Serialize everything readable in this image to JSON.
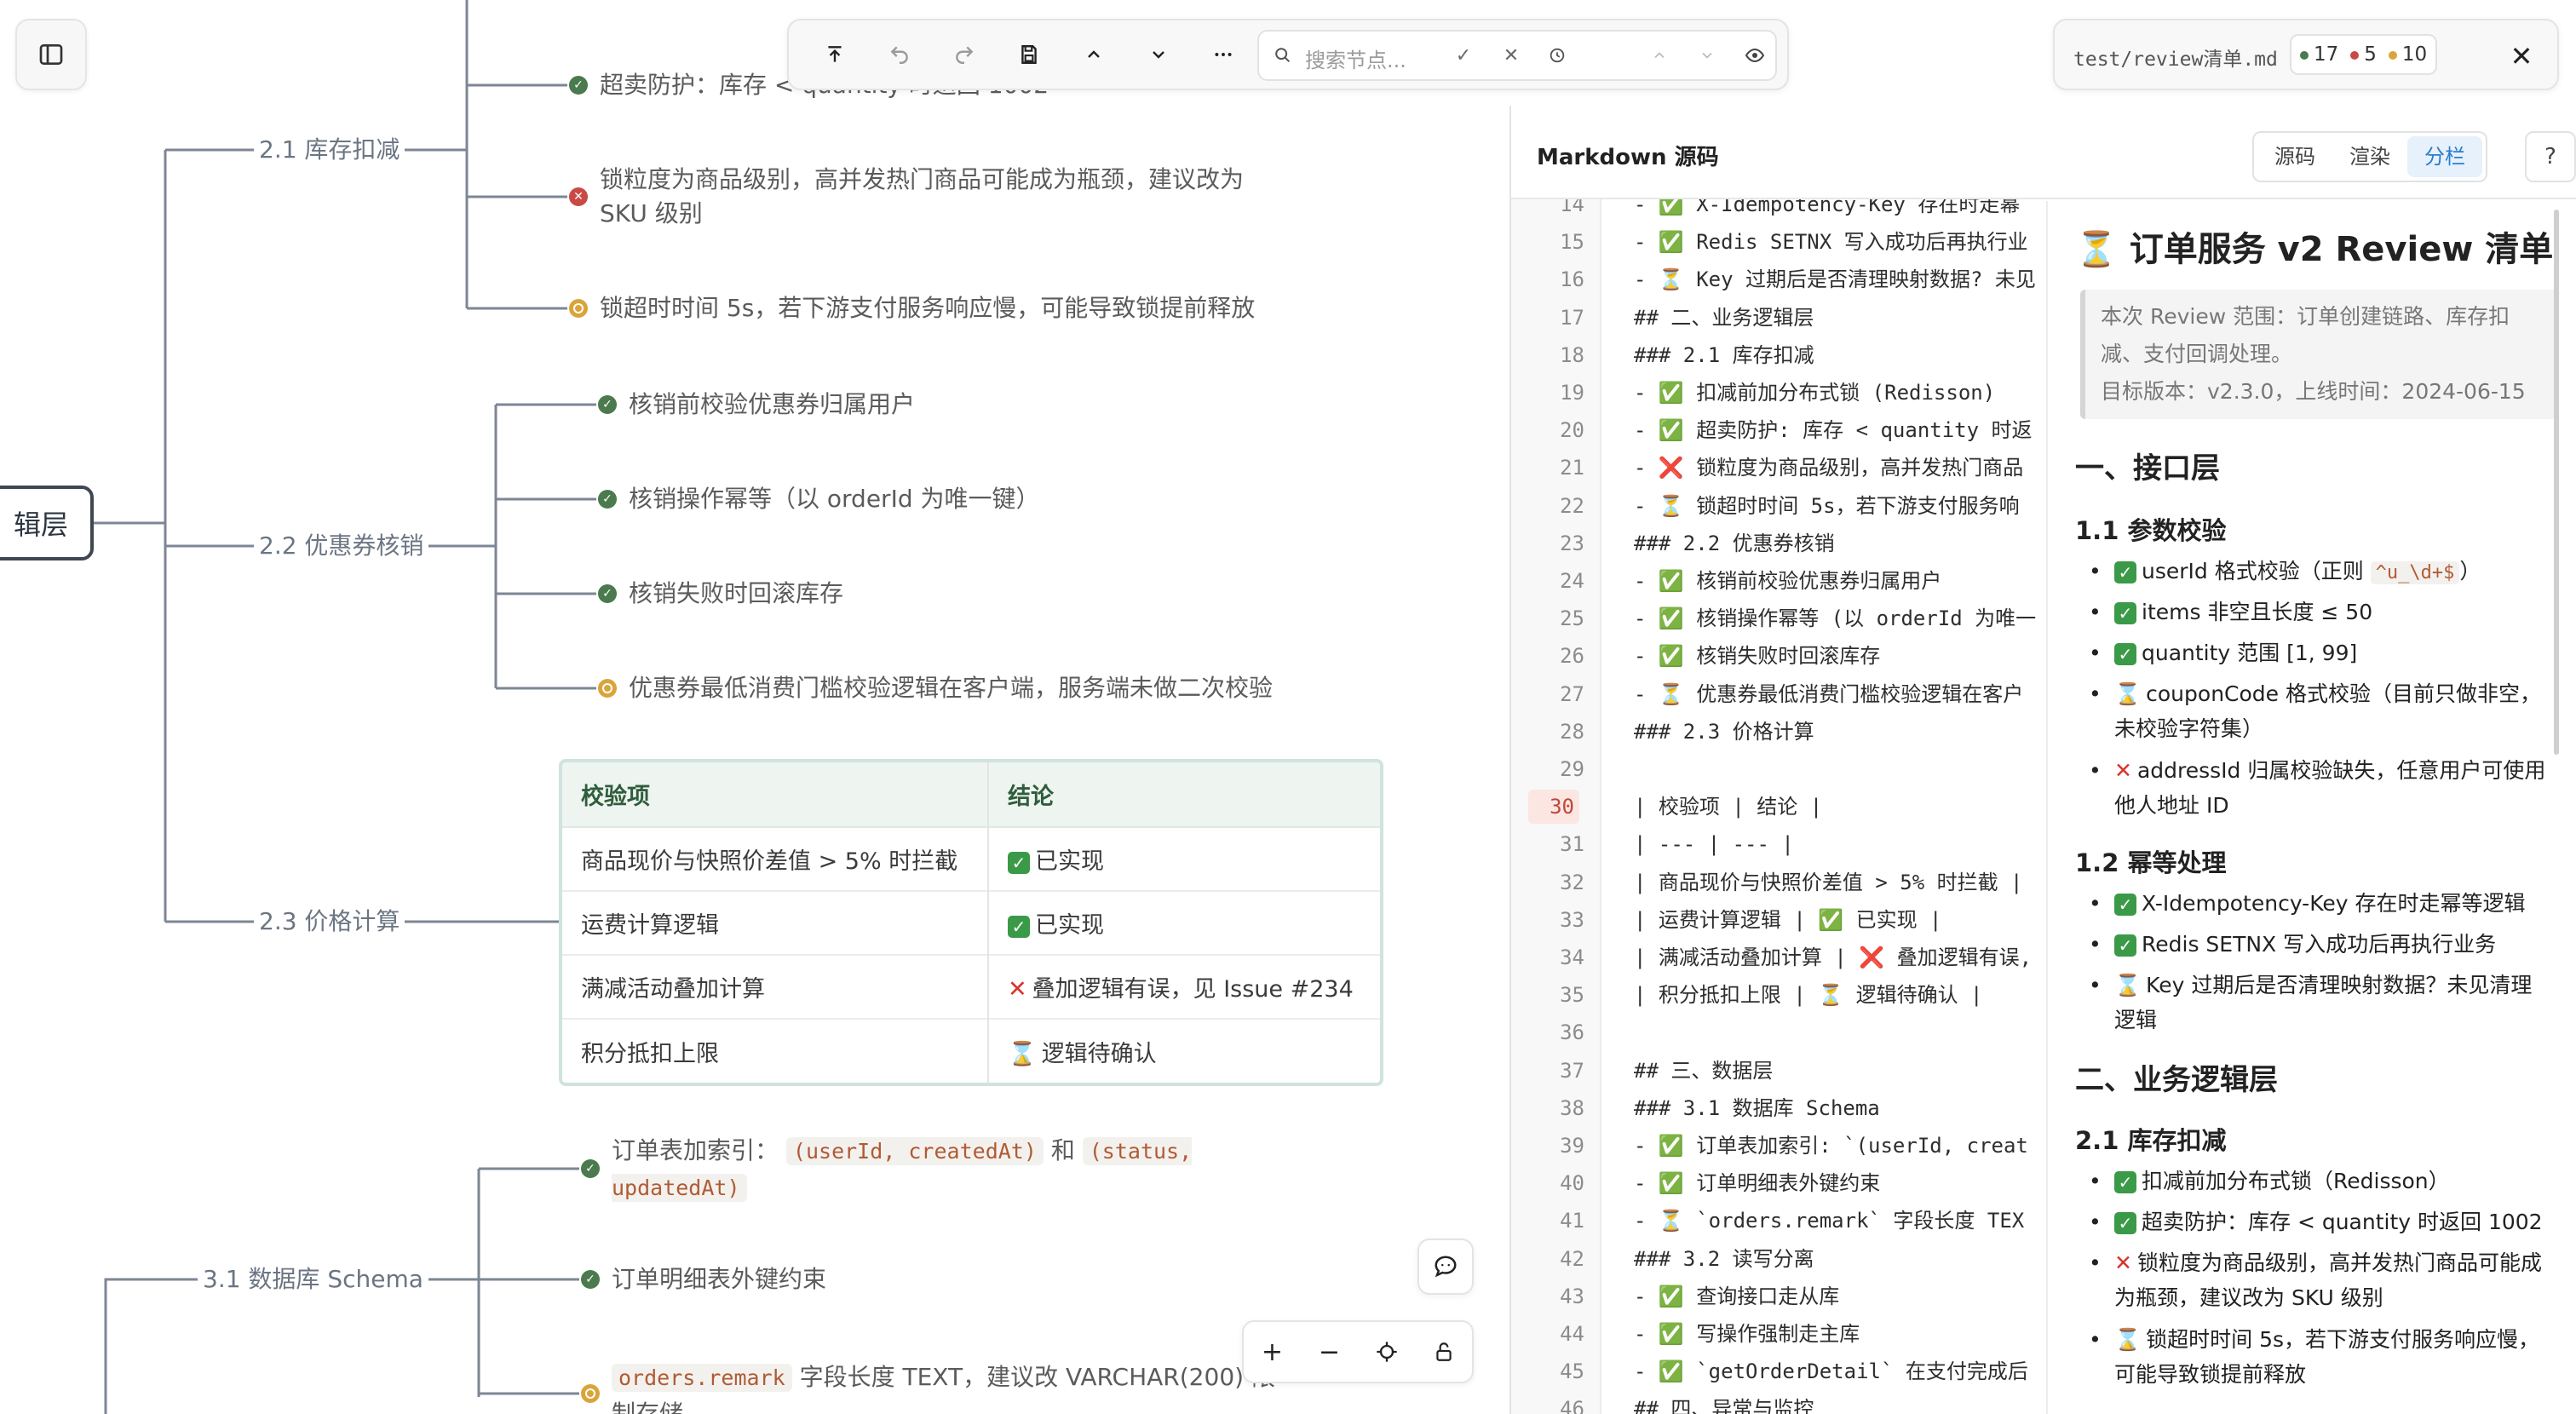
{
  "toolbar": {
    "search_placeholder": "搜索节点..."
  },
  "file": {
    "name": "test/review清单.md",
    "counts": {
      "done": "17",
      "bad": "5",
      "pending": "10"
    },
    "colors": {
      "done": "#4a7a4e",
      "bad": "#c94a44",
      "pending": "#d9a53a"
    }
  },
  "mindmap": {
    "root_label": "辑层",
    "branches": {
      "b21": "2.1 库存扣减",
      "b22": "2.2 优惠券核销",
      "b23": "2.3 价格计算",
      "b31": "3.1 数据库 Schema"
    },
    "leaves": {
      "l211": "超卖防护：库存 < quantity 时返回 1002",
      "l212": "锁粒度为商品级别，高并发热门商品可能成为瓶颈，建议改为 SKU 级别",
      "l213": "锁超时时间 5s，若下游支付服务响应慢，可能导致锁提前释放",
      "l221": "核销前校验优惠券归属用户",
      "l222": "核销操作幂等（以 orderId 为唯一键）",
      "l223": "核销失败时回滚库存",
      "l224": "优惠券最低消费门槛校验逻辑在客户端，服务端未做二次校验",
      "l311_a": "订单表加索引：",
      "l311_c1": "(userId, createdAt)",
      "l311_and": "和",
      "l311_c2": "(status, updatedAt)",
      "l312": "订单明细表外键约束",
      "l313_code": "orders.remark",
      "l313_text": "字段长度 TEXT，建议改 VARCHAR(200) 限制存储"
    },
    "table": {
      "headers": [
        "校验项",
        "结论"
      ],
      "rows": [
        {
          "item": "商品现价与快照价差值 > 5% 时拦截",
          "status": "done",
          "result": "已实现"
        },
        {
          "item": "运费计算逻辑",
          "status": "done",
          "result": "已实现"
        },
        {
          "item": "满减活动叠加计算",
          "status": "bad",
          "result": "叠加逻辑有误，见 Issue #234"
        },
        {
          "item": "积分抵扣上限",
          "status": "pending",
          "result": "逻辑待确认"
        }
      ]
    }
  },
  "markdown_panel": {
    "title": "Markdown 源码",
    "tabs": [
      "源码",
      "渲染",
      "分栏"
    ],
    "active_tab": "分栏",
    "help": "?",
    "current_line": "30",
    "lines": [
      {
        "n": "14",
        "t": "- ✅ X-Idempotency-Key 存在时走幂"
      },
      {
        "n": "15",
        "t": "- ✅ Redis SETNX 写入成功后再执行业"
      },
      {
        "n": "16",
        "t": "- ⏳ Key 过期后是否清理映射数据? 未见"
      },
      {
        "n": "17",
        "t": "## 二、业务逻辑层"
      },
      {
        "n": "18",
        "t": "### 2.1 库存扣减"
      },
      {
        "n": "19",
        "t": "- ✅ 扣减前加分布式锁 (Redisson)"
      },
      {
        "n": "20",
        "t": "- ✅ 超卖防护: 库存 < quantity 时返"
      },
      {
        "n": "21",
        "t": "- ❌ 锁粒度为商品级别，高并发热门商品"
      },
      {
        "n": "22",
        "t": "- ⏳ 锁超时时间 5s，若下游支付服务响"
      },
      {
        "n": "23",
        "t": "### 2.2 优惠券核销"
      },
      {
        "n": "24",
        "t": "- ✅ 核销前校验优惠券归属用户"
      },
      {
        "n": "25",
        "t": "- ✅ 核销操作幂等 (以 orderId 为唯一"
      },
      {
        "n": "26",
        "t": "- ✅ 核销失败时回滚库存"
      },
      {
        "n": "27",
        "t": "- ⏳ 优惠券最低消费门槛校验逻辑在客户"
      },
      {
        "n": "28",
        "t": "### 2.3 价格计算"
      },
      {
        "n": "29",
        "t": ""
      },
      {
        "n": "30",
        "t": "| 校验项 | 结论 |"
      },
      {
        "n": "31",
        "t": "| --- | --- |"
      },
      {
        "n": "32",
        "t": "| 商品现价与快照价差值 > 5% 时拦截 |"
      },
      {
        "n": "33",
        "t": "| 运费计算逻辑 | ✅ 已实现 |"
      },
      {
        "n": "34",
        "t": "| 满减活动叠加计算 | ❌ 叠加逻辑有误,"
      },
      {
        "n": "35",
        "t": "| 积分抵扣上限 | ⏳ 逻辑待确认 |"
      },
      {
        "n": "36",
        "t": ""
      },
      {
        "n": "37",
        "t": "## 三、数据层"
      },
      {
        "n": "38",
        "t": "### 3.1 数据库 Schema"
      },
      {
        "n": "39",
        "t": "- ✅ 订单表加索引: `(userId, creat"
      },
      {
        "n": "40",
        "t": "- ✅ 订单明细表外键约束"
      },
      {
        "n": "41",
        "t": "- ⏳ `orders.remark` 字段长度 TEX"
      },
      {
        "n": "42",
        "t": "### 3.2 读写分离"
      },
      {
        "n": "43",
        "t": "- ✅ 查询接口走从库"
      },
      {
        "n": "44",
        "t": "- ✅ 写操作强制走主库"
      },
      {
        "n": "45",
        "t": "- ✅ `getOrderDetail` 在支付完成后"
      },
      {
        "n": "46",
        "t": "## 四、异常与监控"
      }
    ],
    "preview": {
      "title": "⏳ 订单服务 v2 Review 清单",
      "quote_1": "本次 Review 范围：订单创建链路、库存扣减、支付回调处理。",
      "quote_2": "目标版本：v2.3.0，上线时间：2024-06-15",
      "h2_1": "一、接口层",
      "h3_11": "1.1 参数校验",
      "i11_1a": "userId 格式校验（正则",
      "i11_1code": "^u_\\d+$",
      "i11_1b": "）",
      "i11_2": "items 非空且长度 ≤ 50",
      "i11_3": "quantity 范围 [1, 99]",
      "i11_4": "couponCode 格式校验（目前只做非空，未校验字符集）",
      "i11_5": "addressId 归属校验缺失，任意用户可使用他人地址 ID",
      "h3_12": "1.2 幂等处理",
      "i12_1": "X-Idempotency-Key 存在时走幂等逻辑",
      "i12_2": "Redis SETNX 写入成功后再执行业务",
      "i12_3": "Key 过期后是否清理映射数据？未见清理逻辑",
      "h2_2": "二、业务逻辑层",
      "h3_21": "2.1 库存扣减",
      "i21_1": "扣减前加分布式锁（Redisson）",
      "i21_2": "超卖防护：库存 < quantity 时返回 1002",
      "i21_3": "锁粒度为商品级别，高并发热门商品可能成为瓶颈，建议改为 SKU 级别",
      "i21_4": "锁超时时间 5s，若下游支付服务响应慢，可能导致锁提前释放"
    }
  }
}
